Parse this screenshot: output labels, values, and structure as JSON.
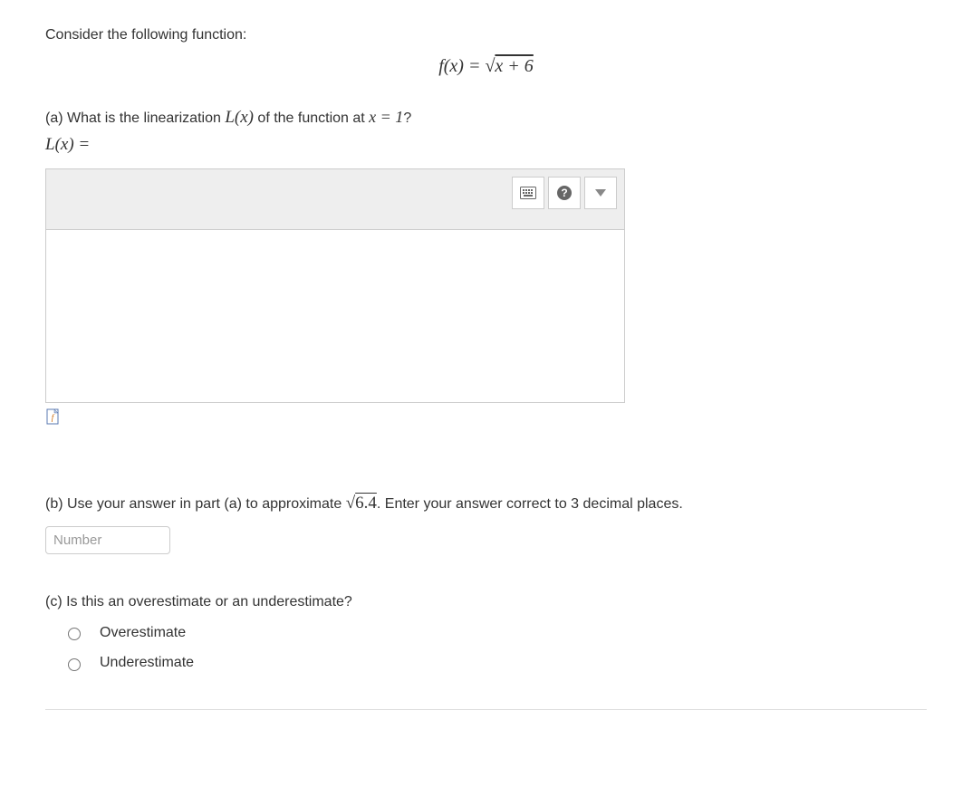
{
  "intro": "Consider the following function:",
  "formula": {
    "lhs": "f(x) = ",
    "sqrt_content": "x + 6"
  },
  "part_a": {
    "prefix": "(a) What is the linearization ",
    "Lx": "L(x)",
    "middle": " of the function at ",
    "xeq": "x = 1",
    "suffix": "?",
    "line2_lhs": "L(x) ="
  },
  "part_b": {
    "prefix": "(b) Use your answer in part (a) to approximate ",
    "sqrt_val": "6.4",
    "suffix": ". Enter your answer correct to 3 decimal places.",
    "placeholder": "Number"
  },
  "part_c": {
    "question": "(c) Is this an overestimate or an underestimate?",
    "opt1": "Overestimate",
    "opt2": "Underestimate"
  }
}
